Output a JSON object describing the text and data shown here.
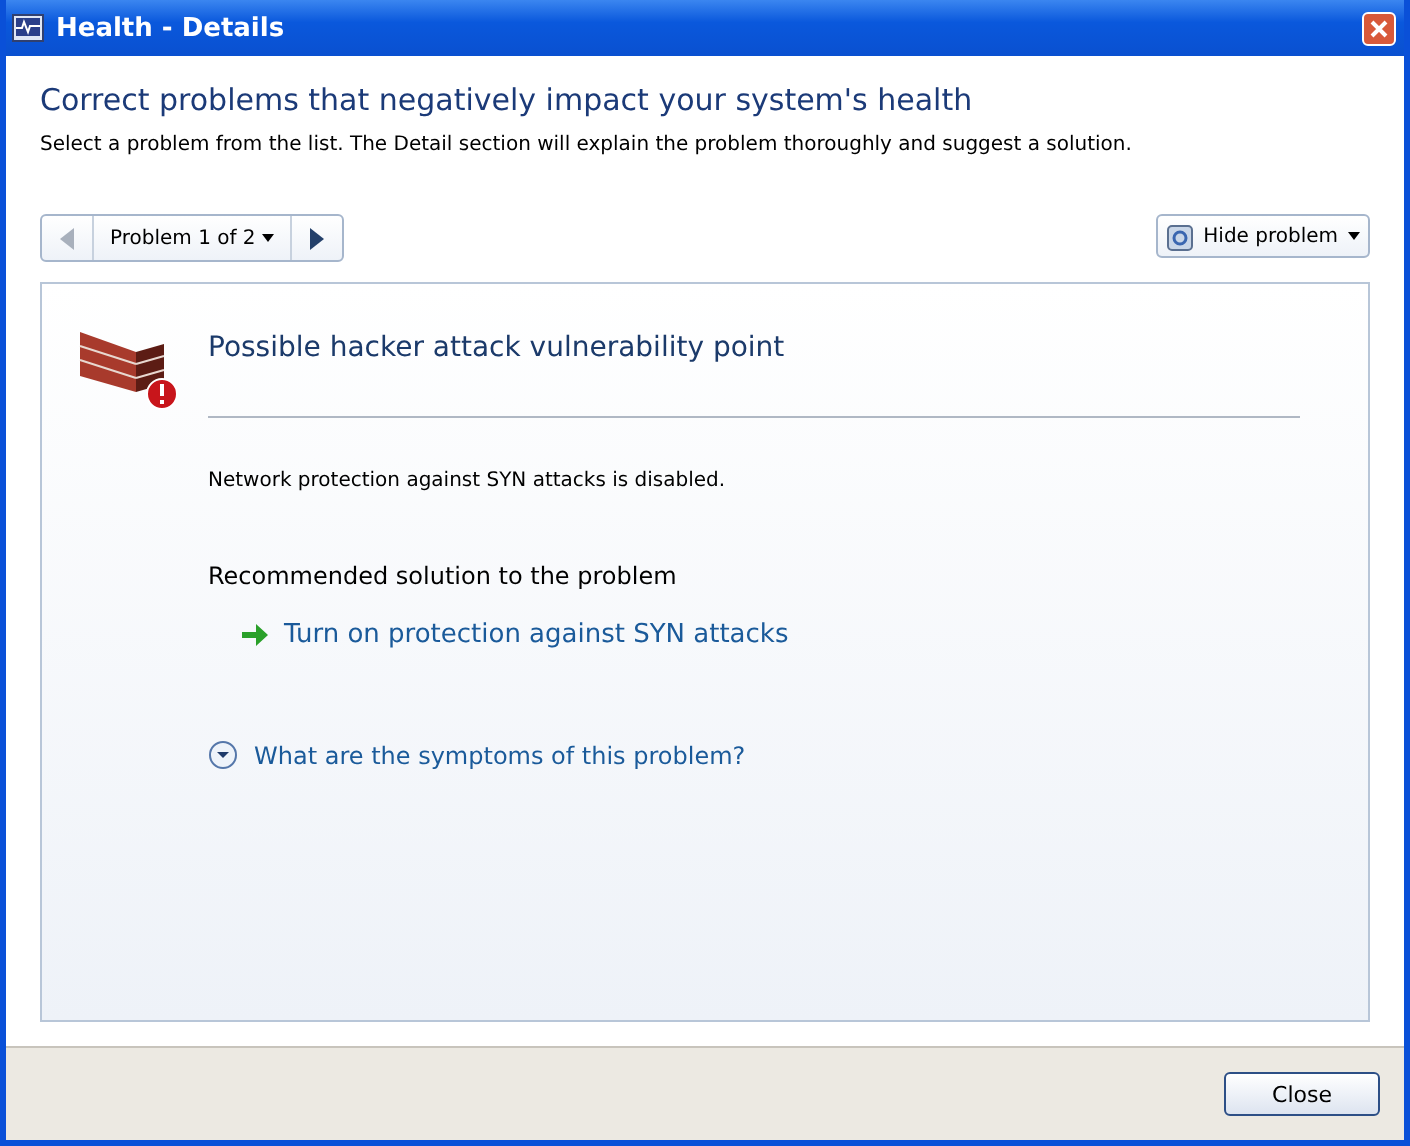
{
  "window": {
    "title": "Health - Details"
  },
  "heading": "Correct problems that negatively impact your system's health",
  "subtitle": "Select a problem from the list. The Detail section will explain the problem thoroughly and suggest a solution.",
  "navigator": {
    "label": "Problem 1 of 2",
    "previous_disabled": true,
    "next_disabled": false
  },
  "hide_button": {
    "label": "Hide problem"
  },
  "problem": {
    "title": "Possible hacker attack vulnerability point",
    "description": "Network protection against SYN attacks is disabled.",
    "solution_heading": "Recommended solution to the problem",
    "solution_link": "Turn on protection against SYN attacks",
    "symptoms_link": "What are the symptoms of this problem?",
    "expanded": false
  },
  "buttons": [
    "Close"
  ]
}
